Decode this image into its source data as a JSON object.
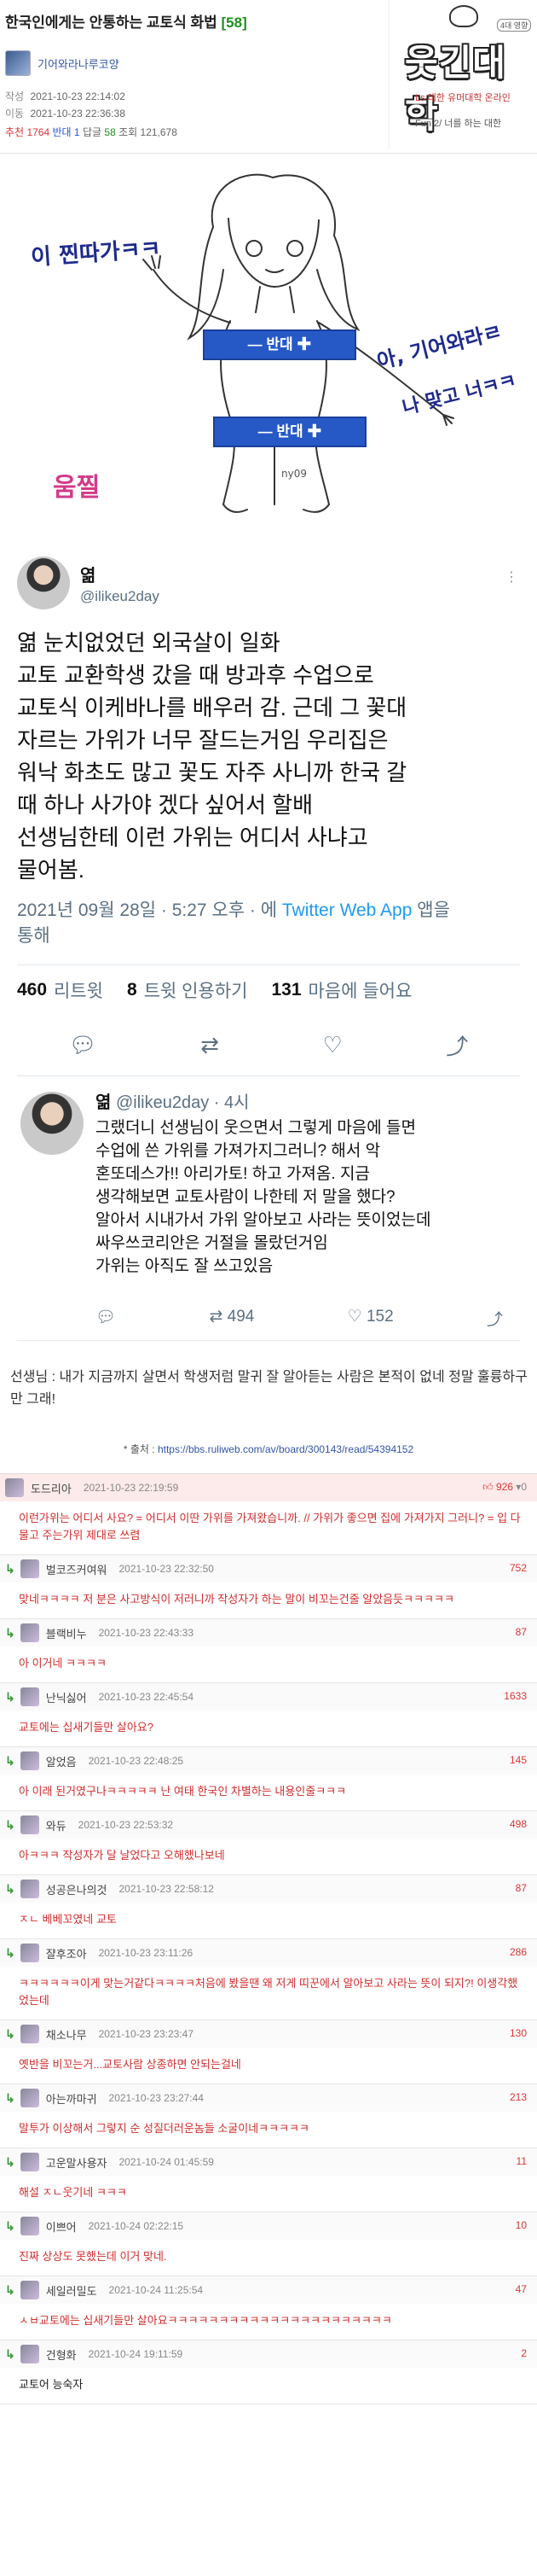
{
  "header": {
    "title": "한국인에게는 안통하는 교토식 화법",
    "comment_count": "[58]",
    "author": "기어와라나루코양",
    "created_label": "작성",
    "created": "2021-10-23 22:14:02",
    "moved_label": "이동",
    "moved": "2021-10-23 22:36:38",
    "up_label": "추천",
    "up": "1764",
    "down_label": "반대",
    "down": "1",
    "reply_label": "답글",
    "reply": "58",
    "views_label": "조회",
    "views": "121,678"
  },
  "logo": {
    "text": "웃긴대학",
    "tag": "4대 영향",
    "sub": "Ls 대한 유머대학 온라인",
    "line": "Fun 2/ 너를 하는 대한"
  },
  "drawing": {
    "left_text": "이 찐따가ㅋㅋ",
    "censor_top": "— 반대 ✚",
    "censor_bottom": "— 반대 ✚",
    "right_text_1": "아, 기어와라ㄹ",
    "right_text_2": "나 맞고 너ㅋㅋ",
    "bottom_left": "움찔",
    "sign": "ny09"
  },
  "tweet": {
    "name": "엶",
    "handle": "@ilikeu2day",
    "body": "엶 눈치없었던 외국살이 일화\n교토 교환학생 갔을 때 방과후 수업으로\n교토식 이케바나를 배우러 감. 근데 그 꽃대\n자르는 가위가 너무 잘드는거임 우리집은\n워낙 화초도 많고 꽃도 자주 사니까 한국 갈\n때 하나 사가야 겠다 싶어서 할배\n선생님한테 이런 가위는 어디서 사냐고\n물어봄.",
    "date": "2021년 09월 28일 · 5:27 오후 · 에 ",
    "app": "Twitter Web App",
    "date_suffix": " 앱을\n통해",
    "retweets": "460",
    "retweets_label": "리트윗",
    "quotes": "8",
    "quotes_label": "트윗 인용하기",
    "likes": "131",
    "likes_label": "마음에 들어요"
  },
  "reply": {
    "name": "엶",
    "handle": "@ilikeu2day · 4시",
    "text": "그랬더니 선생님이 웃으면서 그렇게 마음에 들면\n수업에 쓴 가위를 가져가지그러니? 해서 악\n혼또데스가!! 아리가토! 하고 가져옴. 지금\n생각해보면 교토사람이 나한테 저 말을 했다?\n알아서 시내가서 가위 알아보고 사라는 뜻이었는데\n싸우쓰코리안은 거절을 몰랐던거임\n가위는 아직도 잘 쓰고있음",
    "retweets": "494",
    "likes": "152"
  },
  "caption": {
    "text": "선생님 : 내가 지금까지 살면서 학생저럼 말귀 잘 알아듣는 사람은 본적이 없네 정말 훌륭하구만 그래!",
    "source_label": "* 출처 : ",
    "source_url": "https://bbs.ruliweb.com/av/board/300143/read/54394152"
  },
  "comments": [
    {
      "nick": "도드리아",
      "date": "2021-10-23 22:19:59",
      "likes": "926",
      "best": true,
      "reply": false,
      "body": "이런가위는 어디서 사요? = 어디서 이딴 가위를 가져왔습니까. // 가위가 좋으면 집에 가져가지 그러니? = 입 다물고 주는가위 제대로 쓰렴"
    },
    {
      "nick": "벌코즈커여워",
      "date": "2021-10-23 22:32:50",
      "likes": "752",
      "best": false,
      "reply": true,
      "body": "맞네ㅋㅋㅋㅋ 저 분은 사고방식이 저러니까 작성자가 하는 말이 비꼬는건줄 알았음듯ㅋㅋㅋㅋㅋ"
    },
    {
      "nick": "블랙비누",
      "date": "2021-10-23 22:43:33",
      "likes": "87",
      "best": false,
      "reply": true,
      "body": "아 이거네 ㅋㅋㅋㅋ"
    },
    {
      "nick": "난닉싫어",
      "date": "2021-10-23 22:45:54",
      "likes": "1633",
      "best": false,
      "reply": true,
      "body": "교토에는 십새기들만 살아요?"
    },
    {
      "nick": "알었음",
      "date": "2021-10-23 22:48:25",
      "likes": "145",
      "best": false,
      "reply": true,
      "body": "아 이래 된거였구나ㅋㅋㅋㅋㅋ 난 여태 한국인 차별하는 내용인줄ㅋㅋㅋ"
    },
    {
      "nick": "와듀",
      "date": "2021-10-23 22:53:32",
      "likes": "498",
      "best": false,
      "reply": true,
      "body": "아ㅋㅋㅋ 작성자가 달 날었다고 오해했나보네"
    },
    {
      "nick": "성공은나의것",
      "date": "2021-10-23 22:58:12",
      "likes": "87",
      "best": false,
      "reply": true,
      "body": "ㅈㄴ 베베꼬였네 교토"
    },
    {
      "nick": "쟐후조아",
      "date": "2021-10-23 23:11:26",
      "likes": "286",
      "best": false,
      "reply": true,
      "body": "ㅋㅋㅋㅋㅋㅋ이게 맞는거같다ㅋㅋㅋㅋ처음에 봤을땐 왜 저게 띠꾼에서 알아보고 사라는 뜻이 되지?! 이생각했었는데"
    },
    {
      "nick": "채소나무",
      "date": "2021-10-23 23:23:47",
      "likes": "130",
      "best": false,
      "reply": true,
      "body": "옛반을 비꼬는거...교토사람 상종하면 안되는걸네"
    },
    {
      "nick": "아는까마귀",
      "date": "2021-10-23 23:27:44",
      "likes": "213",
      "best": false,
      "reply": true,
      "body": "말투가 이상해서 그렇지 순 성질더러운놈들 소굴이네ㅋㅋㅋㅋㅋ"
    },
    {
      "nick": "고운말사용자",
      "date": "2021-10-24 01:45:59",
      "likes": "11",
      "best": false,
      "reply": true,
      "body": "해설 ㅈㄴ웃기네 ㅋㅋㅋ"
    },
    {
      "nick": "이쁘어",
      "date": "2021-10-24 02:22:15",
      "likes": "10",
      "best": false,
      "reply": true,
      "body": "진짜 상상도 못했는데 이거 맞네."
    },
    {
      "nick": "세일러밀도",
      "date": "2021-10-24 11:25:54",
      "likes": "47",
      "best": false,
      "reply": true,
      "body": "ㅅㅂ교토에는 십새기들만 살아요ㅋㅋㅋㅋㅋㅋㅋㅋㅋㅋㅋㅋㅋㅋㅋㅋㅋㅋㅋㅋㅋㅋ"
    },
    {
      "nick": "건형화",
      "date": "2021-10-24 19:11:59",
      "likes": "2",
      "best": false,
      "reply": true,
      "plain": true,
      "body": "교토어 능숙자"
    }
  ]
}
